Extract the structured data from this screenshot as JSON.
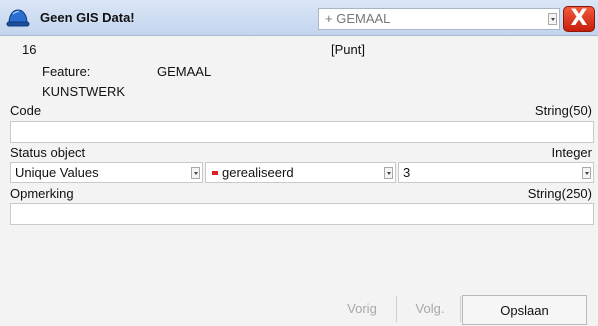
{
  "titlebar": {
    "title": "Geen GIS Data!",
    "feature_selected": "+ GEMAAL",
    "close_label": "X"
  },
  "record": {
    "id": "16",
    "type": "[Punt]",
    "feature_label": "Feature:",
    "feature_value": "GEMAAL",
    "subtype": "KUNSTWERK"
  },
  "fields": {
    "code": {
      "label": "Code",
      "type": "String(50)",
      "value": ""
    },
    "status": {
      "label": "Status object",
      "type": "Integer",
      "mode": "Unique Values",
      "value_label": "gerealiseerd",
      "value_code": "3"
    },
    "opmerking": {
      "label": "Opmerking",
      "type": "String(250)",
      "value": ""
    }
  },
  "buttons": {
    "prev": "Vorig",
    "next": "Volg.",
    "save": "Opslaan"
  },
  "icons": {
    "app": "hard-hat-icon",
    "close": "close-icon",
    "marker": "red-marker-icon"
  },
  "colors": {
    "accent_close": "#d42a10",
    "titlebar": "#c3d5ee",
    "marker": "#e02020"
  }
}
